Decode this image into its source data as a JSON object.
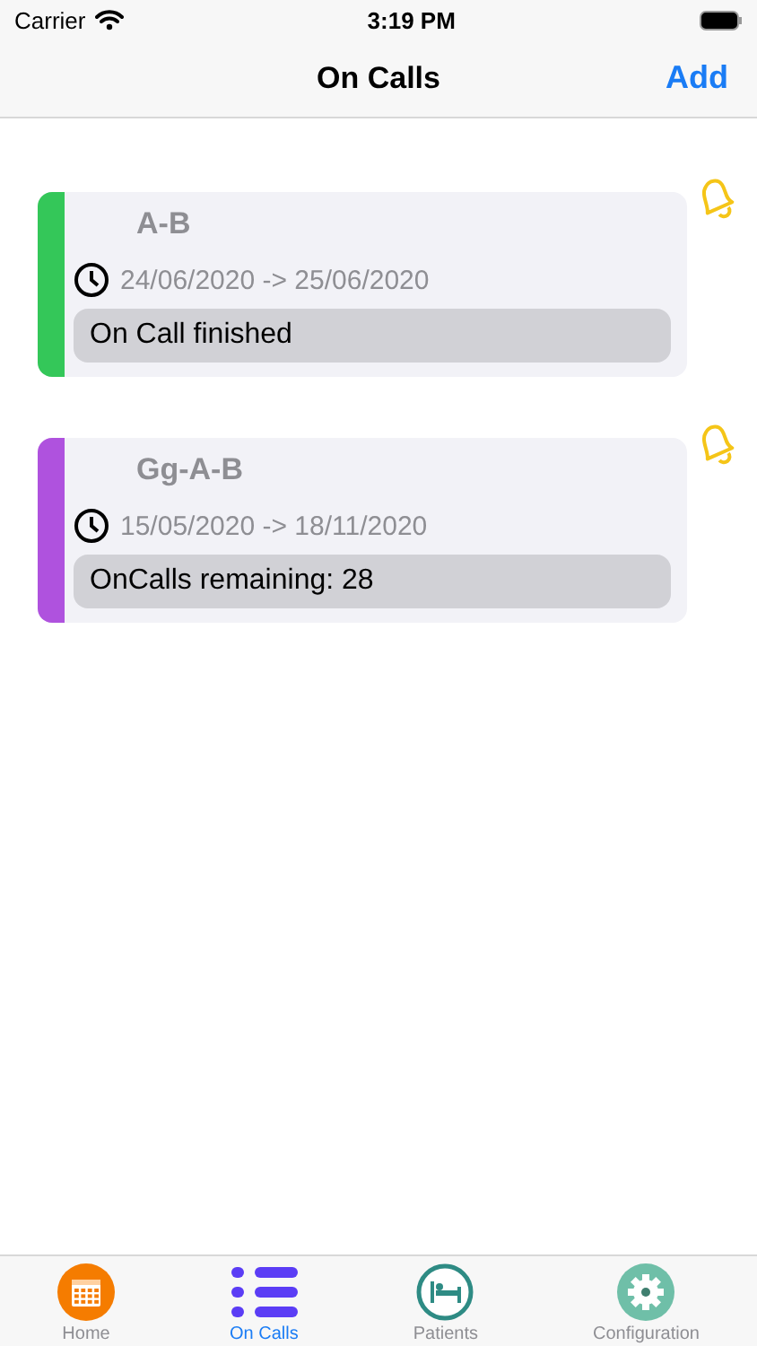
{
  "status_bar": {
    "carrier": "Carrier",
    "time": "3:19 PM"
  },
  "nav": {
    "title": "On Calls",
    "action": "Add"
  },
  "cards": [
    {
      "title": "A-B",
      "dates": "24/06/2020 -> 25/06/2020",
      "status": "On Call finished",
      "color": "#34c759"
    },
    {
      "title": "Gg-A-B",
      "dates": "15/05/2020 -> 18/11/2020",
      "status": "OnCalls remaining: 28",
      "color": "#af52de"
    }
  ],
  "tabs": [
    {
      "label": "Home",
      "kind": "calendar",
      "selected": false
    },
    {
      "label": "On Calls",
      "kind": "list",
      "selected": true
    },
    {
      "label": "Patients",
      "kind": "bed",
      "selected": false
    },
    {
      "label": "Configuration",
      "kind": "gear",
      "selected": false
    }
  ]
}
